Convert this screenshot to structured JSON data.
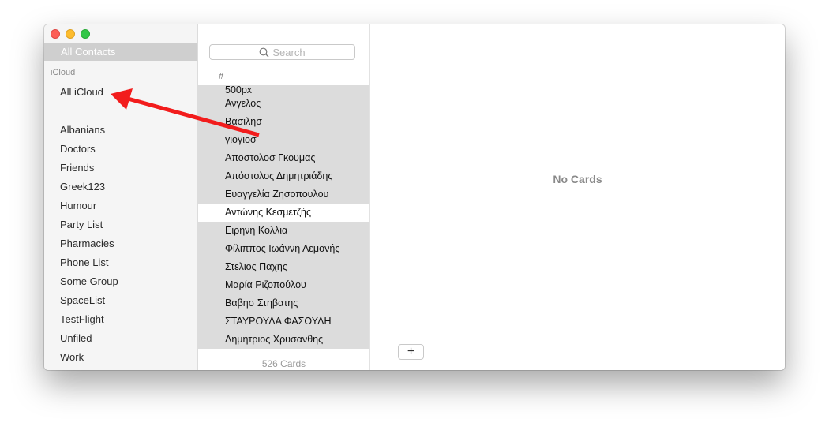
{
  "window": {
    "controls": [
      "close",
      "minimize",
      "zoom"
    ]
  },
  "sidebar": {
    "all_contacts_label": "All Contacts",
    "section_header": "iCloud",
    "all_icloud_label": "All iCloud",
    "groups": [
      "Albanians",
      "Doctors",
      "Friends",
      "Greek123",
      "Humour",
      "Party List",
      "Pharmacies",
      "Phone List",
      "Some Group",
      "SpaceList",
      "TestFlight",
      "Unfiled",
      "Work"
    ]
  },
  "list": {
    "search_placeholder": "Search",
    "section_index": "#",
    "contacts": [
      {
        "name": "500px",
        "selected": false
      },
      {
        "name": "Ανγελος",
        "selected": false
      },
      {
        "name": "Βασιλησ",
        "selected": false
      },
      {
        "name": "γιογιοσ",
        "selected": false
      },
      {
        "name": "Αποστολοσ Γκουμας",
        "selected": false
      },
      {
        "name": "Απόστολος Δημητριάδης",
        "selected": false
      },
      {
        "name": "Ευαγγελία Ζησοπουλου",
        "selected": false
      },
      {
        "name": "Αντώνης Κεσμετζής",
        "selected": true
      },
      {
        "name": "Ειρηνη Κολλια",
        "selected": false
      },
      {
        "name": "Φίλιππος Ιωάννη Λεμονής",
        "selected": false
      },
      {
        "name": "Στελιος Παχης",
        "selected": false
      },
      {
        "name": "Μαρία Ριζοπούλου",
        "selected": false
      },
      {
        "name": "Βαβησ Στηβατης",
        "selected": false
      },
      {
        "name": "ΣΤΑΥΡΟΥΛΑ ΦΑΣΟΥΛΗ",
        "selected": false
      },
      {
        "name": "Δημητριος Χρυσανθης",
        "selected": false
      }
    ],
    "count_label": "526 Cards"
  },
  "detail": {
    "empty_label": "No Cards",
    "add_button_label": "+"
  },
  "annotation": {
    "color": "#f21c1c",
    "points_to": "All iCloud"
  }
}
